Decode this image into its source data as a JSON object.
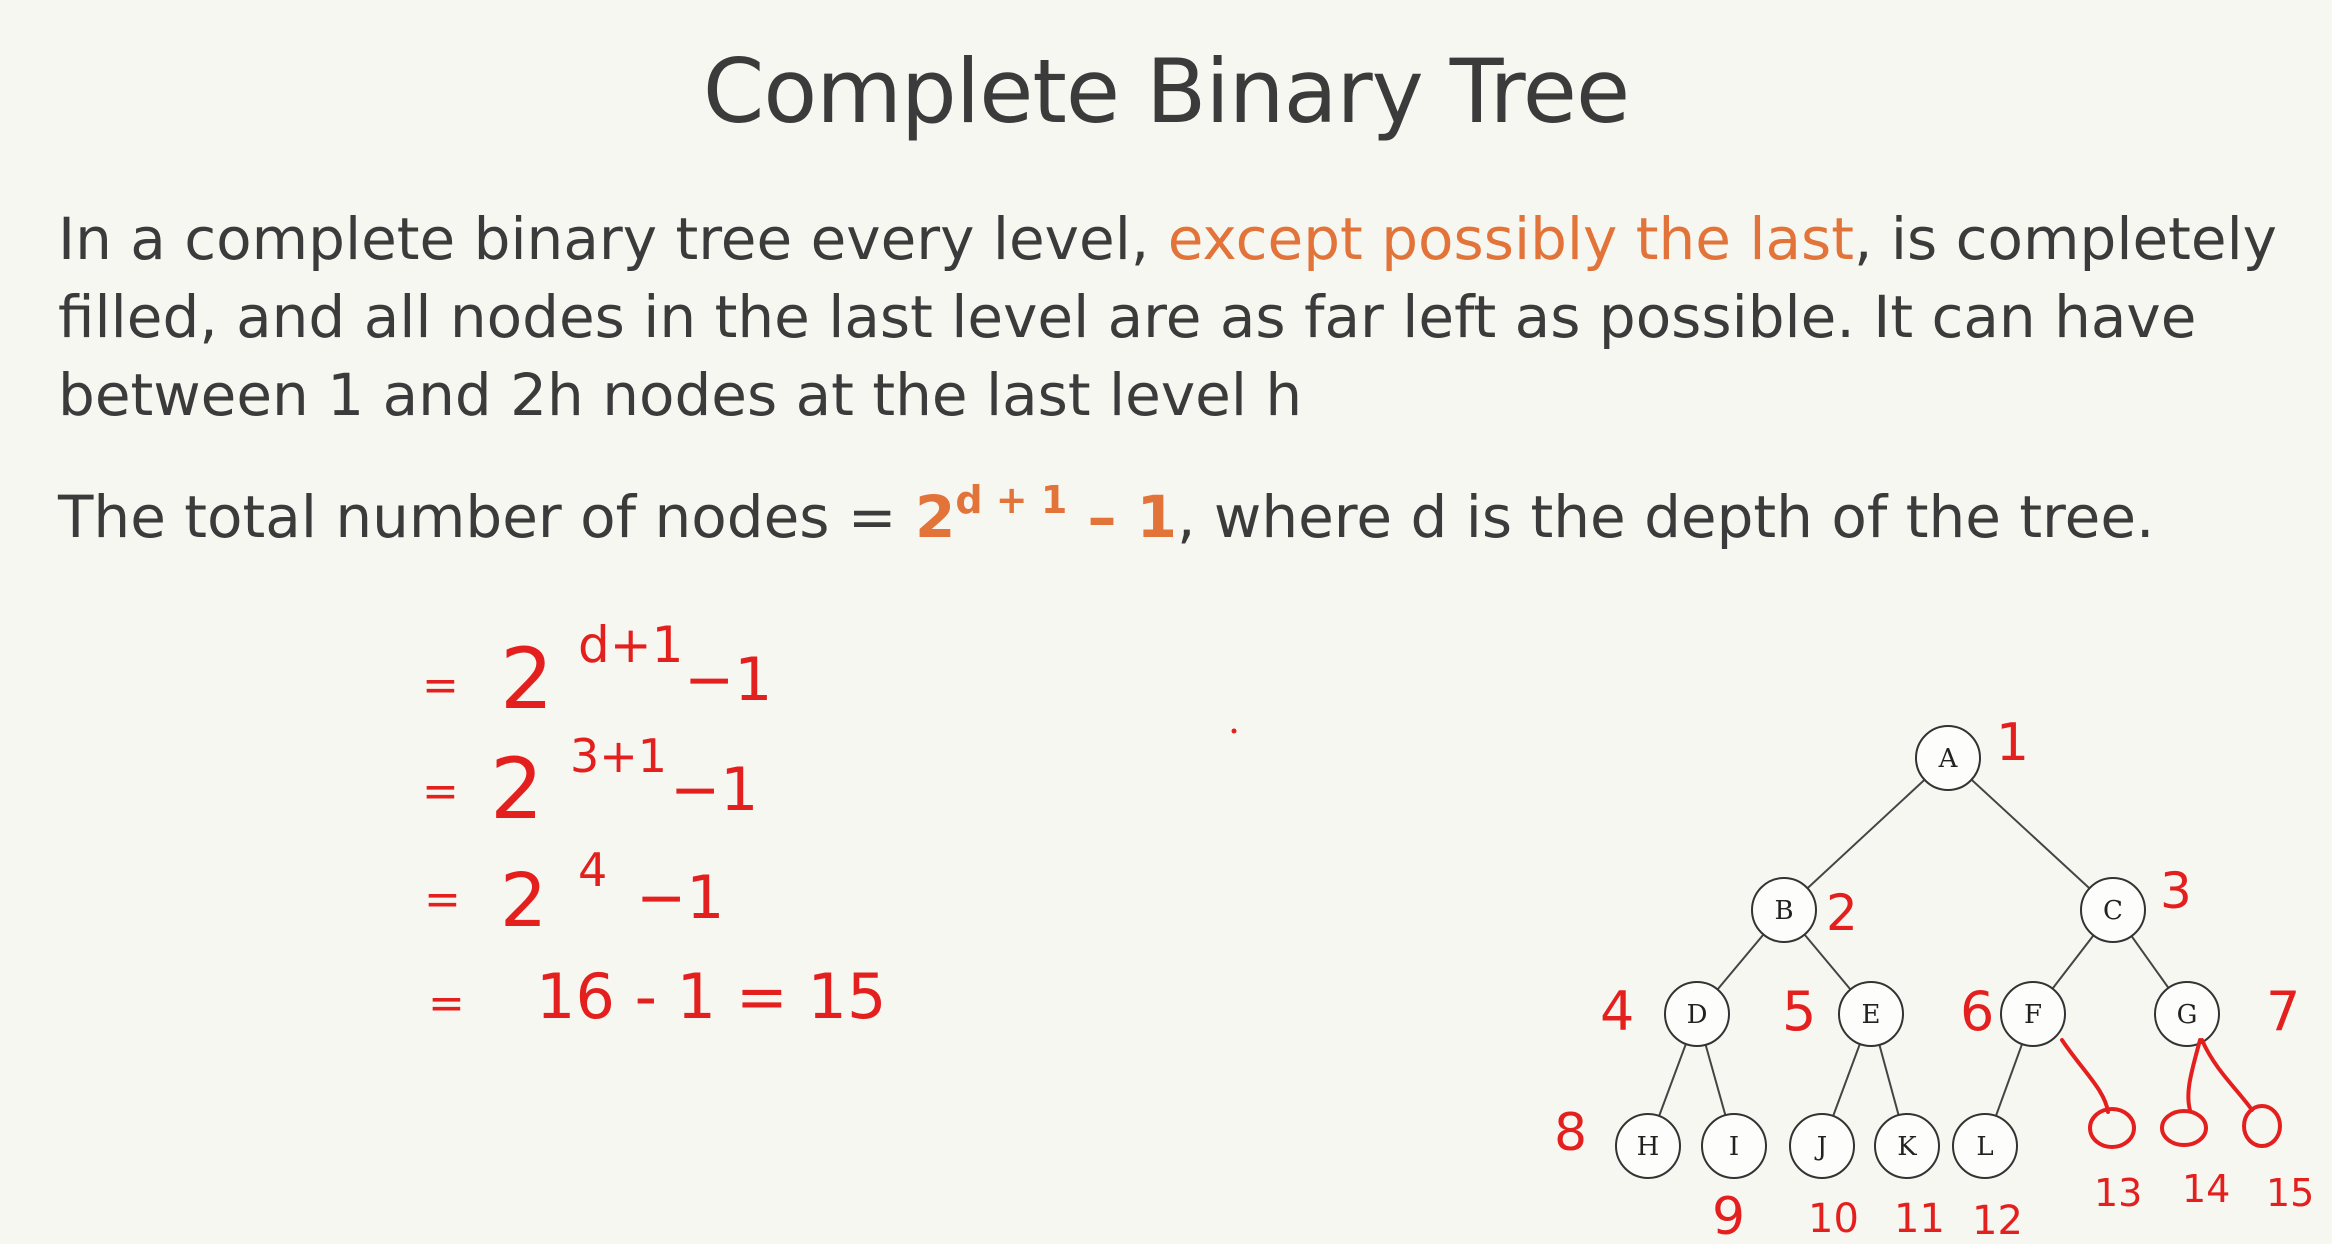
{
  "title": "Complete Binary Tree",
  "paragraph1": {
    "before": "In a complete binary tree every level, ",
    "highlight": "except possibly the last",
    "after": ", is completely filled, and all nodes in the last level are as far left as possible. It can have between 1 and 2h nodes at the last level h"
  },
  "paragraph2": {
    "before": "The total number of nodes = ",
    "formula_base": "2",
    "formula_exp": "d + 1",
    "formula_tail": " – 1",
    "after": ", where d is the depth of the tree."
  },
  "handwritten_calc": {
    "lines": [
      {
        "eq": "=",
        "expr": "2",
        "sup": "d+1",
        "tail": "−1"
      },
      {
        "eq": "=",
        "expr": "2",
        "sup": "3+1",
        "tail": "−1"
      },
      {
        "eq": "=",
        "expr": "2",
        "sup": "4",
        "tail": "−1"
      },
      {
        "eq": "=",
        "expr": "16 - 1 = 15",
        "sup": "",
        "tail": ""
      }
    ]
  },
  "tree": {
    "nodes": [
      "A",
      "B",
      "C",
      "D",
      "E",
      "F",
      "G",
      "H",
      "I",
      "J",
      "K",
      "L"
    ],
    "index_labels": [
      "1",
      "2",
      "3",
      "4",
      "5",
      "6",
      "7",
      "8",
      "9",
      "10",
      "11",
      "12",
      "13",
      "14",
      "15"
    ]
  },
  "colors": {
    "text": "#3b3b3b",
    "accent": "#e2743a",
    "ink": "#e4201f",
    "background": "#f7f7f2"
  }
}
